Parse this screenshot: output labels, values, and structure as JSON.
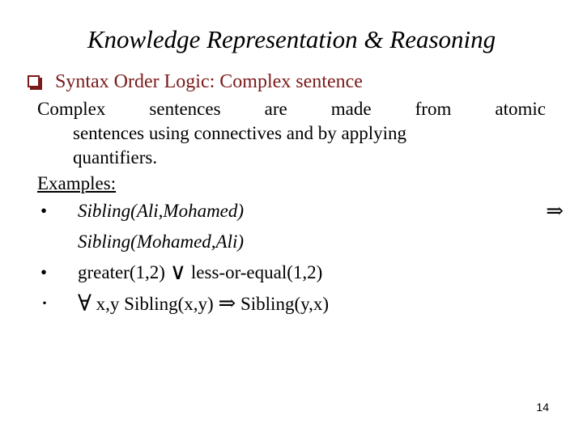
{
  "slide": {
    "title": "Knowledge Representation & Reasoning",
    "page_number": "14",
    "heading": {
      "bullet_glyph": "hollow-square-bullet",
      "text": "Syntax Order Logic: Complex sentence",
      "color": "#7B1A1A"
    },
    "paragraph": {
      "line_1_a": "Complex",
      "line_1_b": "sentences",
      "line_1_c": "are",
      "line_1_d": "made",
      "line_1_e": "from",
      "line_1_f": "atomic",
      "line_2": "sentences using connectives and by applying",
      "line_3": "quantifiers.",
      "full_text": "Complex sentences are made from atomic sentences using connectives and by applying quantifiers."
    },
    "examples_label": "Examples:",
    "examples": [
      {
        "bullet": "dot",
        "line_1_text": "Sibling(Ali,Mohamed)",
        "line_1_trailing_symbol": "⇒",
        "line_2_text": "Sibling(Mohamed,Ali)",
        "style": "italic"
      },
      {
        "bullet": "dot",
        "left_term": "greater(1,2)",
        "operator": "∨",
        "right_term": "less-or-equal(1,2)",
        "style": "roman"
      },
      {
        "bullet": "small-dot",
        "quantifier": "∀",
        "variables": "x,y",
        "left_term": "Sibling(x,y)",
        "operator": "⇒",
        "right_term": "Sibling(y,x)",
        "style": "roman"
      }
    ]
  }
}
